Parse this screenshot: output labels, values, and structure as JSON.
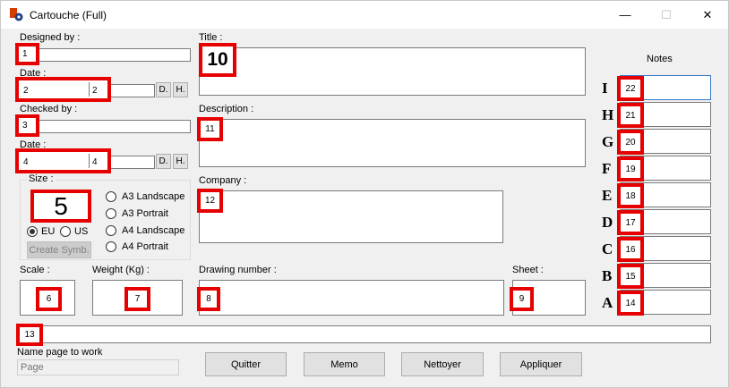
{
  "window": {
    "title": "Cartouche (Full)",
    "minimize": "—",
    "maximize": "☐",
    "close": "✕"
  },
  "labels": {
    "designed_by": "Designed by :",
    "date1": "Date :",
    "checked_by": "Checked by :",
    "date2": "Date :",
    "size": "Size :",
    "title": "Title :",
    "description": "Description :",
    "company": "Company :",
    "scale": "Scale :",
    "weight": "Weight (Kg) :",
    "drawing_number": "Drawing number :",
    "sheet": "Sheet :",
    "notes": "Notes",
    "name_page": "Name page to work"
  },
  "markers": {
    "m1": "1",
    "m2a": "2",
    "m2b": "2",
    "m3": "3",
    "m4a": "4",
    "m4b": "4",
    "m5": "5",
    "m6": "6",
    "m7": "7",
    "m8": "8",
    "m9": "9",
    "m10": "10",
    "m11": "11",
    "m12": "12",
    "m13": "13",
    "m14": "14",
    "m15": "15",
    "m16": "16",
    "m17": "17",
    "m18": "18",
    "m19": "19",
    "m20": "20",
    "m21": "21",
    "m22": "22"
  },
  "date_buttons": {
    "d": "D.",
    "h": "H."
  },
  "size_options": {
    "eu": "EU",
    "us": "US",
    "create_symb": "Create Symb.",
    "a3_landscape": "A3 Landscape",
    "a3_portrait": "A3 Portrait",
    "a4_landscape": "A4 Landscape",
    "a4_portrait": "A4 Portrait"
  },
  "notes_letters": [
    "I",
    "H",
    "G",
    "F",
    "E",
    "D",
    "C",
    "B",
    "A"
  ],
  "page_input": {
    "placeholder": "Page"
  },
  "buttons": {
    "quitter": "Quitter",
    "memo": "Memo",
    "nettoyer": "Nettoyer",
    "appliquer": "Appliquer"
  }
}
